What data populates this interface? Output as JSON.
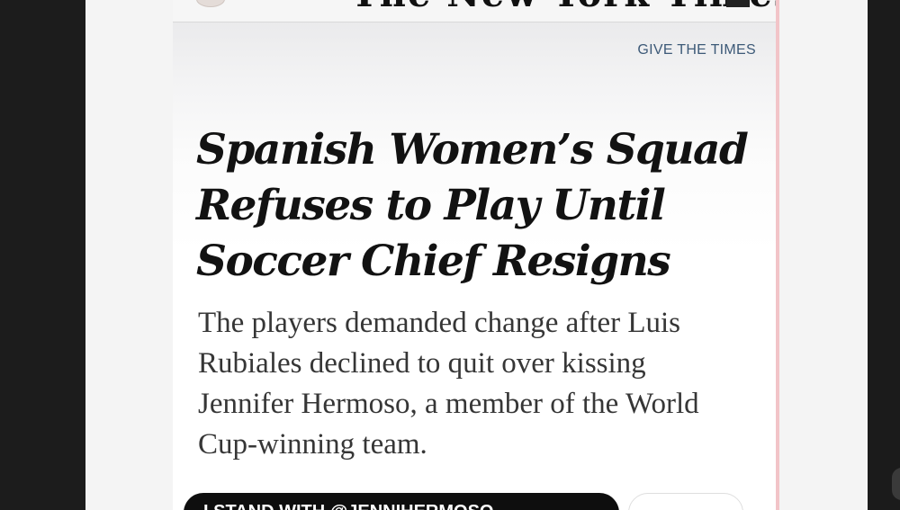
{
  "masthead": {
    "logo_text": "The New York Times"
  },
  "header": {
    "give_link": "GIVE THE TIMES"
  },
  "article": {
    "headline": "Spanish Women’s Squad Refuses to Play Until Soccer Chief Resigns",
    "summary": "The players demanded change after Luis Rubiales declined to quit over kissing Jennifer Hermoso, a member of the World Cup-winning team."
  },
  "sticker": {
    "label": "I STAND WITH @JENNIHERMOSO"
  },
  "colors": {
    "link": "#3d5a78",
    "headline": "#121212",
    "summary": "#363636",
    "sticker_bg": "#0e0e0e",
    "card_border": "#f2c4c8"
  },
  "icons": {
    "masthead_left": "seal-icon",
    "masthead_right": "menu-icon"
  }
}
